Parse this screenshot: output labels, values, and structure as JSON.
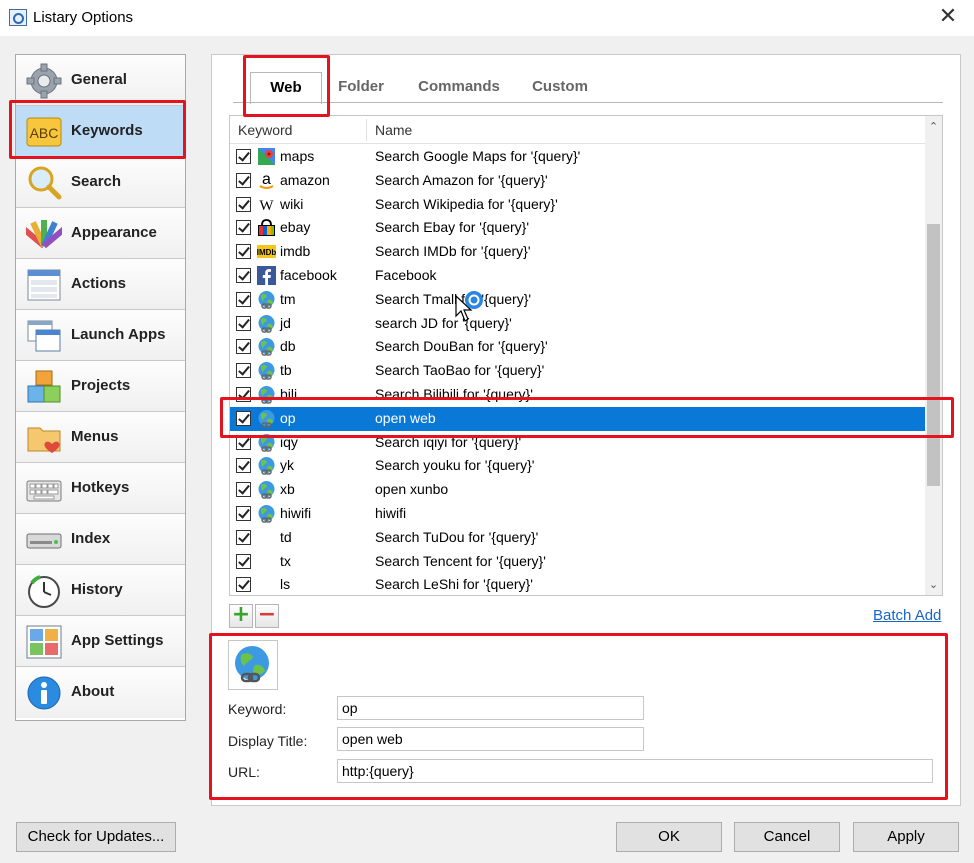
{
  "window": {
    "title": "Listary Options",
    "close_glyph": "✕"
  },
  "sidebar": {
    "items": [
      {
        "label": "General",
        "icon": "gear-icon"
      },
      {
        "label": "Keywords",
        "icon": "abc-icon",
        "active": true
      },
      {
        "label": "Search",
        "icon": "magnifier-icon"
      },
      {
        "label": "Appearance",
        "icon": "palette-icon"
      },
      {
        "label": "Actions",
        "icon": "actions-list-icon"
      },
      {
        "label": "Launch Apps",
        "icon": "windows-icon"
      },
      {
        "label": "Projects",
        "icon": "cubes-icon"
      },
      {
        "label": "Menus",
        "icon": "folder-heart-icon"
      },
      {
        "label": "Hotkeys",
        "icon": "keyboard-icon"
      },
      {
        "label": "Index",
        "icon": "drive-icon"
      },
      {
        "label": "History",
        "icon": "clock-icon"
      },
      {
        "label": "App Settings",
        "icon": "app-grid-icon"
      },
      {
        "label": "About",
        "icon": "info-icon"
      }
    ],
    "abc_text": "ABC"
  },
  "tabs": [
    {
      "label": "Web",
      "active": true
    },
    {
      "label": "Folder"
    },
    {
      "label": "Commands"
    },
    {
      "label": "Custom"
    }
  ],
  "list": {
    "headers": {
      "keyword": "Keyword",
      "name": "Name"
    },
    "rows": [
      {
        "keyword": "maps",
        "name": "Search Google Maps for '{query}'",
        "icon": "maps-icon",
        "checked": true
      },
      {
        "keyword": "amazon",
        "name": "Search Amazon for '{query}'",
        "icon": "amazon-icon",
        "checked": true
      },
      {
        "keyword": "wiki",
        "name": "Search Wikipedia for '{query}'",
        "icon": "wikipedia-icon",
        "checked": true
      },
      {
        "keyword": "ebay",
        "name": "Search Ebay for '{query}'",
        "icon": "ebay-icon",
        "checked": true
      },
      {
        "keyword": "imdb",
        "name": "Search IMDb for '{query}'",
        "icon": "imdb-icon",
        "checked": true
      },
      {
        "keyword": "facebook",
        "name": "Facebook",
        "icon": "facebook-icon",
        "checked": true
      },
      {
        "keyword": "tm",
        "name": "Search Tmall for '{query}'",
        "icon": "globe-icon",
        "checked": true
      },
      {
        "keyword": "jd",
        "name": "search JD for '{query}'",
        "icon": "globe-icon",
        "checked": true
      },
      {
        "keyword": "db",
        "name": "Search DouBan for '{query}'",
        "icon": "globe-icon",
        "checked": true
      },
      {
        "keyword": "tb",
        "name": "Search TaoBao for '{query}'",
        "icon": "globe-icon",
        "checked": true
      },
      {
        "keyword": "bili",
        "name": "Search Bilibili for '{query}'",
        "icon": "globe-icon",
        "checked": true
      },
      {
        "keyword": "op",
        "name": "open web",
        "icon": "globe-icon",
        "checked": true,
        "selected": true
      },
      {
        "keyword": "iqy",
        "name": "Search iqiyi for '{query}'",
        "icon": "globe-icon",
        "checked": true
      },
      {
        "keyword": "yk",
        "name": "Search youku for '{query}'",
        "icon": "globe-icon",
        "checked": true
      },
      {
        "keyword": "xb",
        "name": "open xunbo",
        "icon": "globe-icon",
        "checked": true
      },
      {
        "keyword": "hiwifi",
        "name": "hiwifi",
        "icon": "globe-icon",
        "checked": true
      },
      {
        "keyword": "td",
        "name": "Search TuDou for '{query}'",
        "icon": "",
        "checked": true
      },
      {
        "keyword": "tx",
        "name": "Search Tencent for '{query}'",
        "icon": "",
        "checked": true
      },
      {
        "keyword": "ls",
        "name": "Search LeShi for '{query}'",
        "icon": "",
        "checked": true
      }
    ],
    "scroll_up_glyph": "⌃",
    "scroll_down_glyph": "⌄"
  },
  "list_actions": {
    "add": "+",
    "remove": "−",
    "batch_add": "Batch Add"
  },
  "detail": {
    "keyword_label": "Keyword:",
    "keyword_value": "op",
    "title_label": "Display Title:",
    "title_value": "open web",
    "url_label": "URL:",
    "url_value": "http:{query}"
  },
  "buttons": {
    "check_updates": "Check for Updates...",
    "ok": "OK",
    "cancel": "Cancel",
    "apply": "Apply"
  },
  "colors": {
    "highlight": "#e3141f",
    "selection": "#0a78d7",
    "active_nav": "#bfdcf7",
    "link": "#1a64c8"
  }
}
